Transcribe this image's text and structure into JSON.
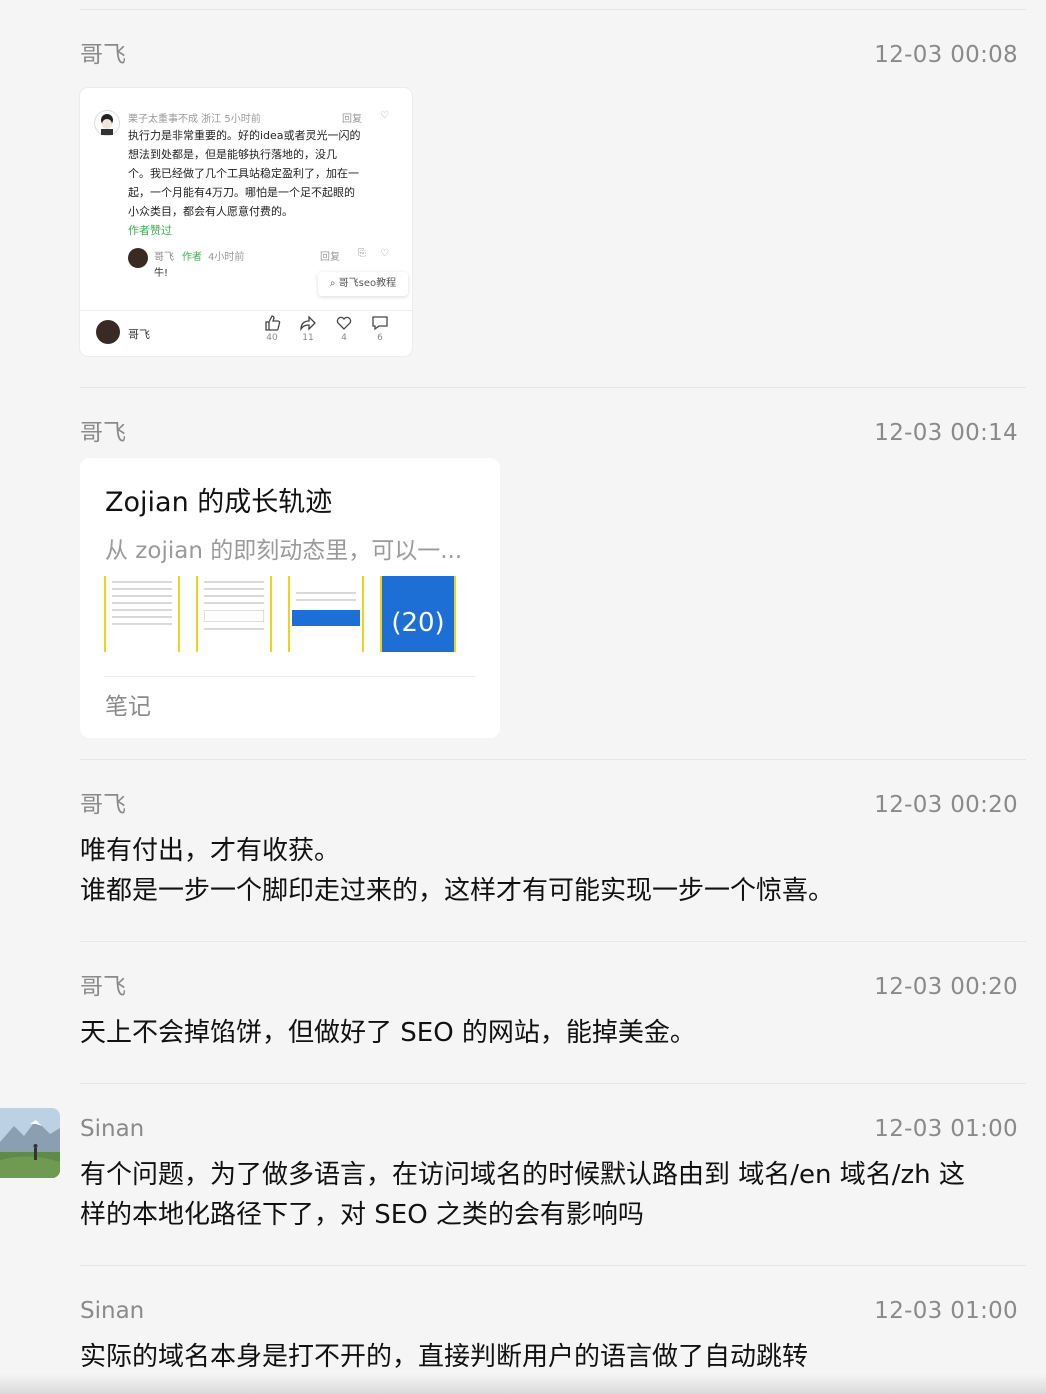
{
  "messages": [
    {
      "sender": "哥飞",
      "time": "12-03 00:08",
      "screenshot": {
        "header": "栗子太重事不成 浙江 5小时前",
        "header_right": "回复",
        "body_lines": [
          "执行力是非常重要的。好的idea或者灵光一闪的",
          "想法到处都是，但是能够执行落地的，没几",
          "个。我已经做了几个工具站稳定盈利了，加在一",
          "起，一个月能有4万刀。哪怕是一个足不起眼的",
          "小众类目，都会有人愿意付费的。"
        ],
        "badge": "作者赞过",
        "reply_name": "哥飞",
        "reply_badge": "作者",
        "reply_time": "4小时前",
        "reply_text": "牛!",
        "reply_action": "回复",
        "search_pill": "哥飞seo教程",
        "footer_name": "哥飞",
        "counts": [
          "40",
          "11",
          "4",
          "6"
        ]
      }
    },
    {
      "sender": "哥飞",
      "time": "12-03 00:14",
      "note": {
        "title": "Zojian 的成长轨迹",
        "desc": "从 zojian 的即刻动态里，可以一...",
        "image_count": "(20)",
        "tag": "笔记"
      }
    },
    {
      "sender": "哥飞",
      "time": "12-03 00:20",
      "lines": [
        "唯有付出，才有收获。",
        "谁都是一步一个脚印走过来的，这样才有可能实现一步一个惊喜。"
      ]
    },
    {
      "sender": "哥飞",
      "time": "12-03 00:20",
      "lines": [
        "天上不会掉馅饼，但做好了 SEO 的网站，能掉美金。"
      ]
    },
    {
      "sender": "Sinan",
      "time": "12-03 01:00",
      "lines": [
        "有个问题，为了做多语言，在访问域名的时候默认路由到 域名/en 域名/zh 这",
        "样的本地化路径下了，对 SEO 之类的会有影响吗"
      ]
    },
    {
      "sender": "Sinan",
      "time": "12-03 01:00",
      "lines": [
        "实际的域名本身是打不开的，直接判断用户的语言做了自动跳转"
      ]
    }
  ]
}
